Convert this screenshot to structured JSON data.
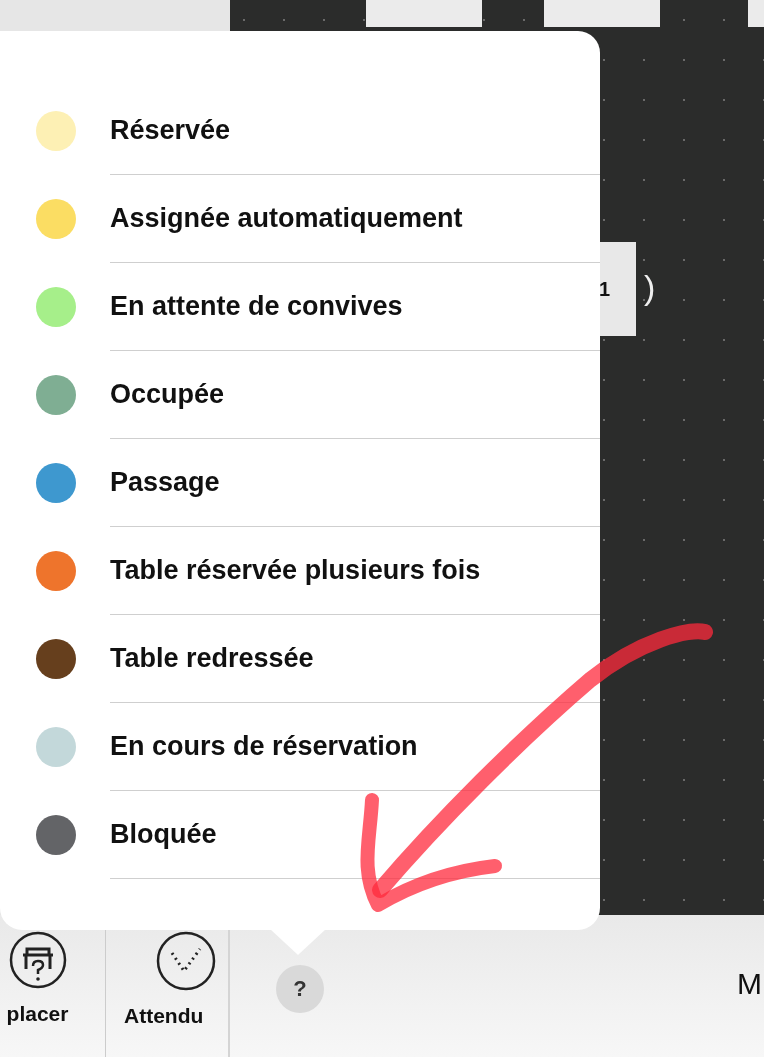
{
  "legend": {
    "items": [
      {
        "label": "Réservée",
        "color": "#fdf0b4"
      },
      {
        "label": "Assignée automatiquement",
        "color": "#fbdd63"
      },
      {
        "label": "En attente de convives",
        "color": "#a6ef8a"
      },
      {
        "label": "Occupée",
        "color": "#7fae93"
      },
      {
        "label": "Passage",
        "color": "#3e98cf"
      },
      {
        "label": "Table réservée plusieurs fois",
        "color": "#ee742c"
      },
      {
        "label": "Table redressée",
        "color": "#663f1d"
      },
      {
        "label": "En cours de réservation",
        "color": "#c3d8da"
      },
      {
        "label": "Bloquée",
        "color": "#636467"
      }
    ]
  },
  "canvas": {
    "table_label": "1",
    "bracket": ")"
  },
  "toolbar": {
    "buttons": [
      {
        "kind": "table-question",
        "label": "placer"
      },
      {
        "kind": "check",
        "label": "Attendu"
      }
    ],
    "help": "?",
    "right_text": "M"
  }
}
